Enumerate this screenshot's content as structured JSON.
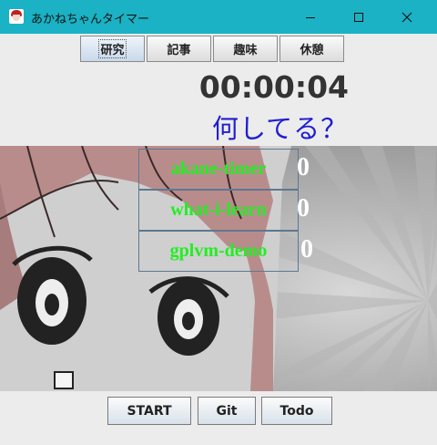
{
  "window": {
    "title": "あかねちゃんタイマー",
    "controls": {
      "minimize": "minimize-icon",
      "maximize": "maximize-icon",
      "close": "close-icon"
    }
  },
  "tabs": [
    {
      "label": "研究",
      "selected": true
    },
    {
      "label": "記事",
      "selected": false
    },
    {
      "label": "趣味",
      "selected": false
    },
    {
      "label": "休憩",
      "selected": false
    }
  ],
  "timer": {
    "elapsed": "00:00:04"
  },
  "status": {
    "prompt": "何してる？"
  },
  "tasks": [
    {
      "name": "akane-timer",
      "count": "0"
    },
    {
      "name": "what-i-learn",
      "count": "0"
    },
    {
      "name": "gplvm-demo",
      "count": "0"
    }
  ],
  "buttons": {
    "start": "START",
    "git": "Git",
    "todo": "Todo"
  },
  "colors": {
    "titlebar": "#1ab2c4",
    "status_text": "#1f1fd0",
    "task_text": "#22ee22"
  }
}
